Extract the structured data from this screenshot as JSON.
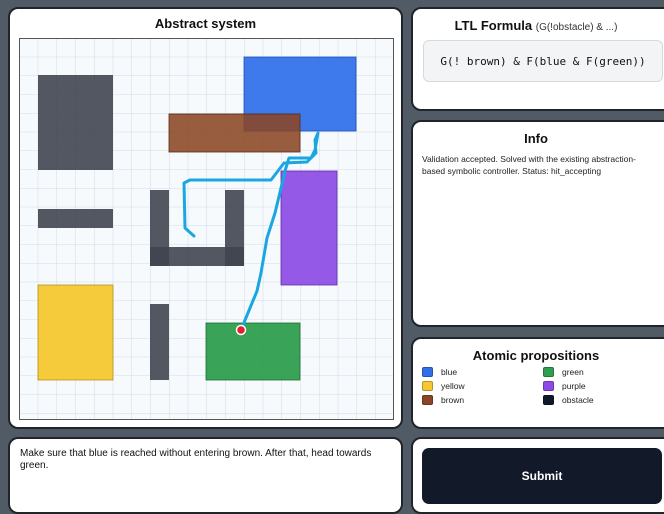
{
  "abstract": {
    "title": "Abstract system"
  },
  "ltl": {
    "title": "LTL Formula",
    "subtitle": "(G(!obstacle) & ...)",
    "formula": "G(! brown) & F(blue & F(green))"
  },
  "info": {
    "title": "Info",
    "text": "Validation accepted. Solved with the existing abstraction-based symbolic controller. Status: hit_accepting"
  },
  "props": {
    "title": "Atomic propositions",
    "items": [
      {
        "label": "blue",
        "color": "#2f6fea"
      },
      {
        "label": "green",
        "color": "#2e9e4f"
      },
      {
        "label": "yellow",
        "color": "#f6c830"
      },
      {
        "label": "purple",
        "color": "#8c4be6"
      },
      {
        "label": "brown",
        "color": "#8b4524"
      },
      {
        "label": "obstacle",
        "color": "#111827"
      }
    ]
  },
  "instruction": {
    "text": "Make sure that blue is reached without entering brown. After that, head towards green."
  },
  "submit": {
    "label": "Submit"
  },
  "map": {
    "colors": {
      "blue": "#2f6fea",
      "green": "#2e9e4f",
      "yellow": "#f6c830",
      "purple": "#8c4be6",
      "brown": "#8b4524",
      "obstacle": "#3f4550",
      "trajectory": "#1aa7e0",
      "start": "#e0202c"
    }
  }
}
